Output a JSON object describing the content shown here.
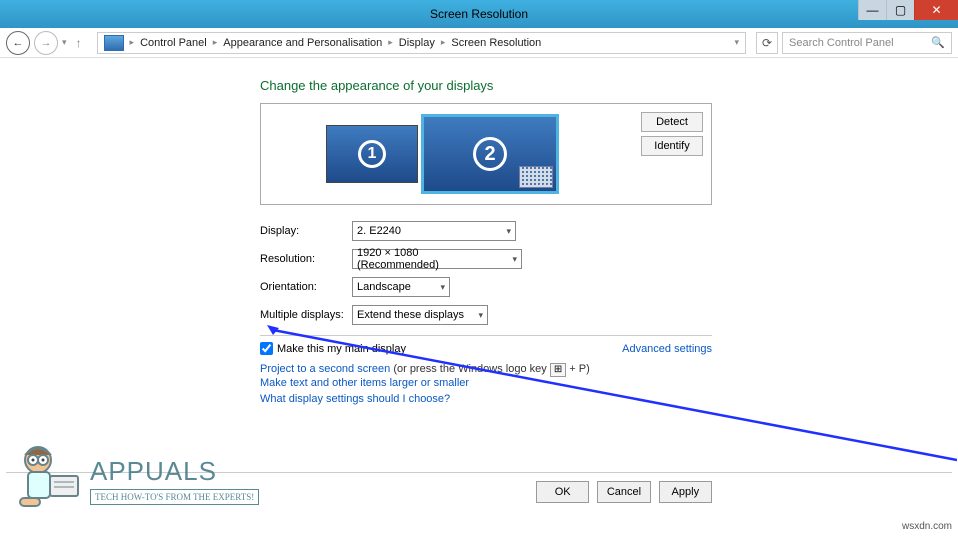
{
  "window": {
    "title": "Screen Resolution"
  },
  "winbuttons": {
    "min": "—",
    "max": "▢",
    "close": "✕"
  },
  "nav": {
    "back": "←",
    "fwd": "→",
    "up": "▾",
    "crumbs": [
      "Control Panel",
      "Appearance and Personalisation",
      "Display",
      "Screen Resolution"
    ],
    "refresh": "⟳",
    "search_placeholder": "Search Control Panel"
  },
  "heading": "Change the appearance of your displays",
  "monitors": {
    "m1": "1",
    "m2": "2"
  },
  "buttons": {
    "detect": "Detect",
    "identify": "Identify",
    "ok": "OK",
    "cancel": "Cancel",
    "apply": "Apply"
  },
  "fields": {
    "display_label": "Display:",
    "display_value": "2. E2240",
    "res_label": "Resolution:",
    "res_value": "1920 × 1080 (Recommended)",
    "orient_label": "Orientation:",
    "orient_value": "Landscape",
    "multi_label": "Multiple displays:",
    "multi_value": "Extend these displays"
  },
  "check": {
    "label": "Make this my main display"
  },
  "adv": "Advanced settings",
  "links": {
    "project": "Project to a second screen",
    "project_hint_a": " (or press the Windows logo key ",
    "project_key": "⊞",
    "project_hint_b": " + P)",
    "larger": "Make text and other items larger or smaller",
    "which": "What display settings should I choose?"
  },
  "brand": {
    "name": "APPUALS",
    "tag": "TECH HOW-TO'S FROM THE EXPERTS!"
  },
  "watermark": "wsxdn.com"
}
